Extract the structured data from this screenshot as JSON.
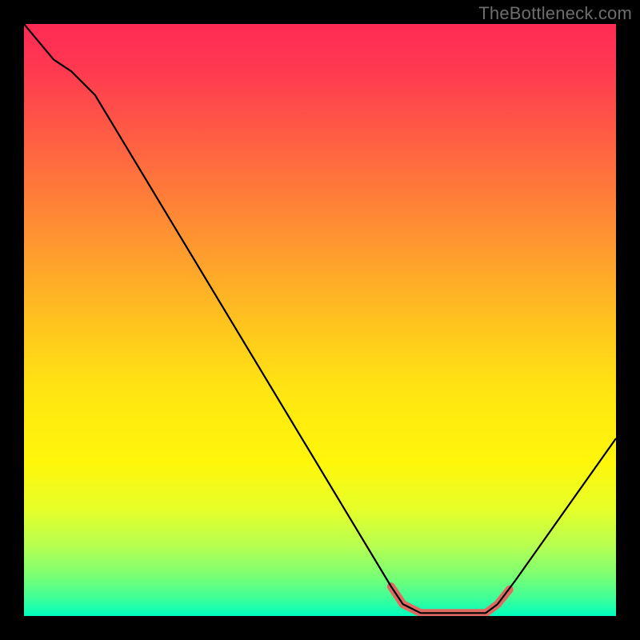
{
  "watermark": "TheBottleneck.com",
  "chart_data": {
    "type": "line",
    "title": "",
    "xlabel": "",
    "ylabel": "",
    "xlim": [
      0,
      100
    ],
    "ylim": [
      0,
      100
    ],
    "grid": false,
    "series": [
      {
        "name": "bottleneck-curve",
        "stroke": "#000000",
        "stroke_width": 2.2,
        "points": [
          {
            "x": 0,
            "y": 100
          },
          {
            "x": 5,
            "y": 94
          },
          {
            "x": 8,
            "y": 92
          },
          {
            "x": 12,
            "y": 88
          },
          {
            "x": 62,
            "y": 5
          },
          {
            "x": 64,
            "y": 2
          },
          {
            "x": 67,
            "y": 0.5
          },
          {
            "x": 78,
            "y": 0.5
          },
          {
            "x": 80,
            "y": 2
          },
          {
            "x": 83,
            "y": 6
          },
          {
            "x": 100,
            "y": 30
          }
        ]
      },
      {
        "name": "trough-highlight",
        "stroke": "#e06a62",
        "stroke_width": 10,
        "stroke_linecap": "round",
        "points": [
          {
            "x": 62,
            "y": 5
          },
          {
            "x": 64,
            "y": 2
          },
          {
            "x": 67,
            "y": 0.5
          },
          {
            "x": 78,
            "y": 0.5
          },
          {
            "x": 80,
            "y": 2
          },
          {
            "x": 82,
            "y": 4.5
          }
        ]
      }
    ],
    "background_gradient": {
      "direction": "vertical",
      "stops": [
        {
          "pos": 0.0,
          "color": "#ff2a55"
        },
        {
          "pos": 0.5,
          "color": "#ffc21f"
        },
        {
          "pos": 0.8,
          "color": "#f5ff20"
        },
        {
          "pos": 1.0,
          "color": "#00ffbf"
        }
      ]
    }
  }
}
